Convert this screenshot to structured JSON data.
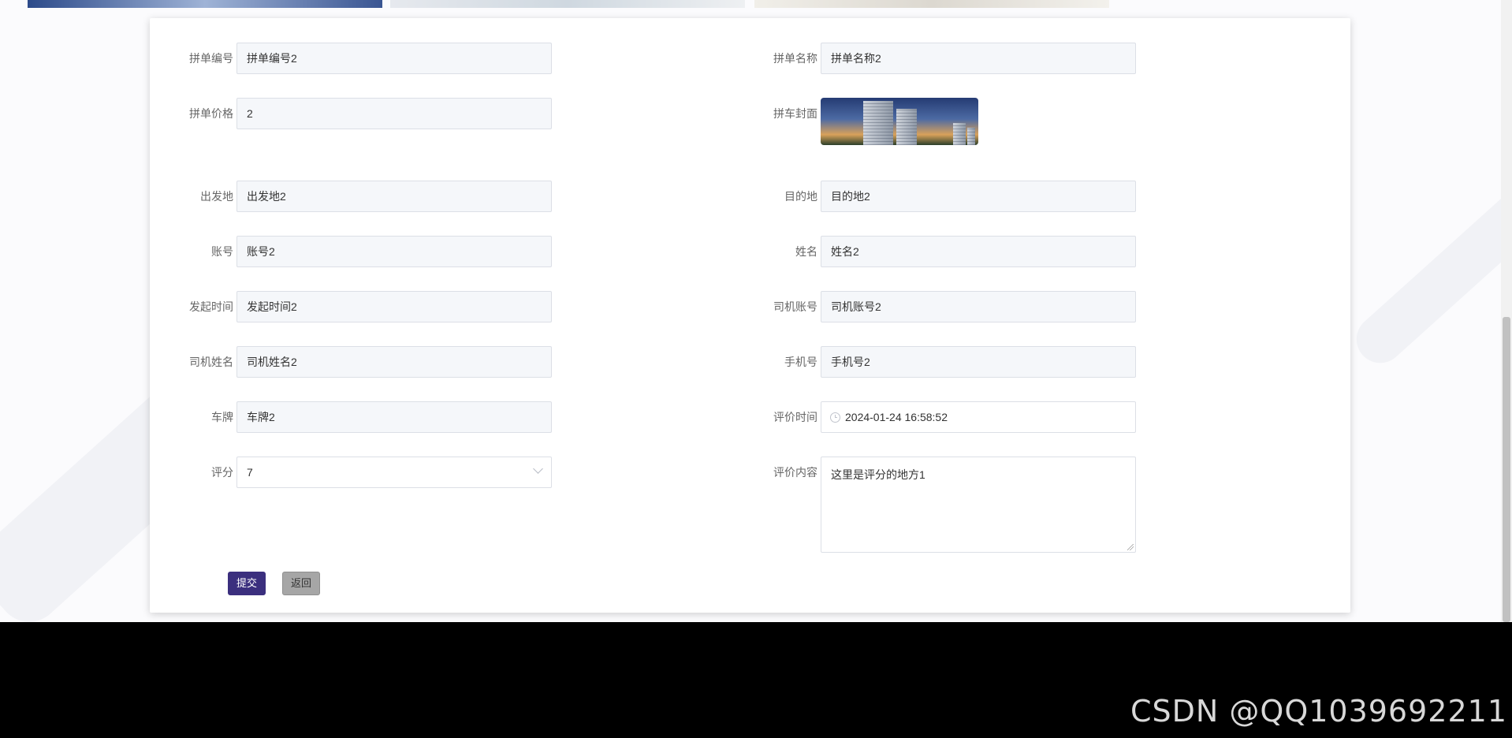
{
  "form": {
    "fields": [
      {
        "label": "拼单编号",
        "value": "拼单编号2"
      },
      {
        "label": "拼单名称",
        "value": "拼单名称2"
      },
      {
        "label": "拼单价格",
        "value": "2"
      },
      {
        "label": "出发地",
        "value": "出发地2"
      },
      {
        "label": "目的地",
        "value": "目的地2"
      },
      {
        "label": "账号",
        "value": "账号2"
      },
      {
        "label": "姓名",
        "value": "姓名2"
      },
      {
        "label": "发起时间",
        "value": "发起时间2"
      },
      {
        "label": "司机账号",
        "value": "司机账号2"
      },
      {
        "label": "司机姓名",
        "value": "司机姓名2"
      },
      {
        "label": "手机号",
        "value": "手机号2"
      },
      {
        "label": "车牌",
        "value": "车牌2"
      }
    ],
    "cover": {
      "label": "拼车封面",
      "image": "building-photo"
    },
    "review_time": {
      "label": "评价时间",
      "value": "2024-01-24 16:58:52",
      "icon": "clock-icon"
    },
    "score": {
      "label": "评分",
      "value": "7",
      "icon": "chevron-down-icon"
    },
    "review_content": {
      "label": "评价内容",
      "value": "这里是评分的地方1"
    },
    "buttons": {
      "submit": "提交",
      "back": "返回"
    }
  },
  "watermark": "CSDN @QQ1039692211",
  "colors": {
    "primary": "#3b2f7e",
    "input_bg": "#f5f7fa",
    "border": "#dcdfe6"
  }
}
